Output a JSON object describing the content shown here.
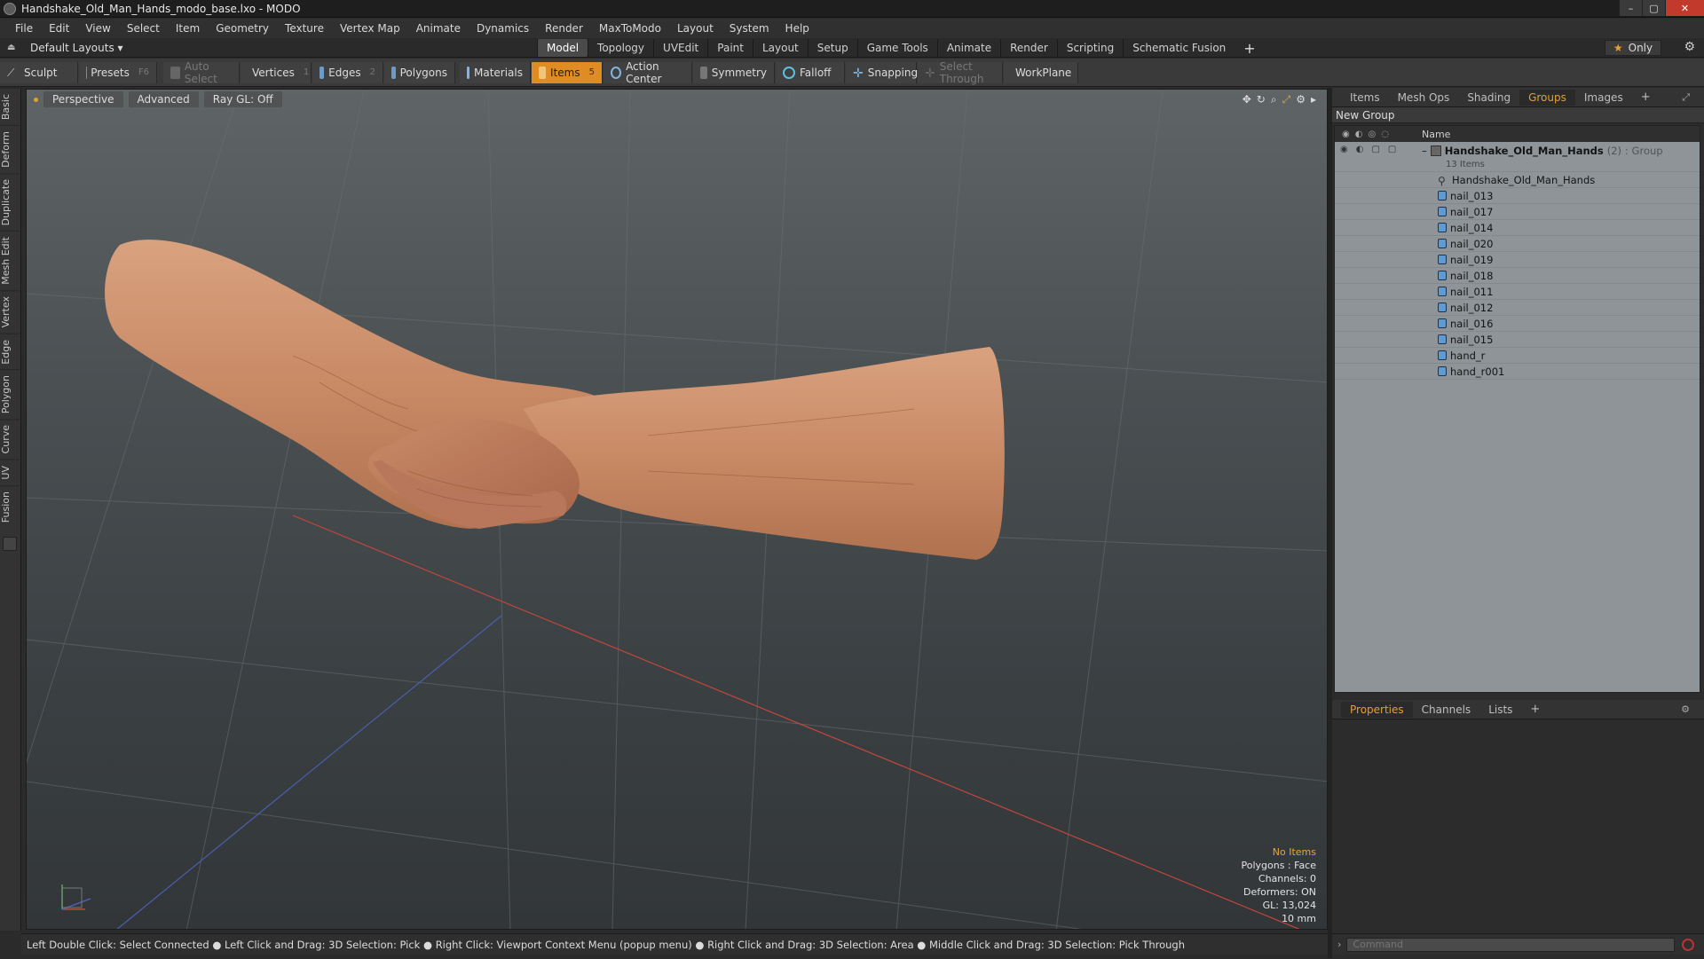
{
  "window": {
    "title": "Handshake_Old_Man_Hands_modo_base.lxo - MODO",
    "min": "–",
    "max": "▢",
    "close": "✕"
  },
  "menu": [
    "File",
    "Edit",
    "View",
    "Select",
    "Item",
    "Geometry",
    "Texture",
    "Vertex Map",
    "Animate",
    "Dynamics",
    "Render",
    "MaxToModo",
    "Layout",
    "System",
    "Help"
  ],
  "layout": {
    "default_layouts": "Default Layouts ▾",
    "tabs": [
      "Model",
      "Topology",
      "UVEdit",
      "Paint",
      "Layout",
      "Setup",
      "Game Tools",
      "Animate",
      "Render",
      "Scripting",
      "Schematic Fusion"
    ],
    "active_tab": "Model",
    "plus": "+",
    "only": "Only"
  },
  "toolbar": {
    "sculpt": "Sculpt",
    "presets": "Presets",
    "presets_key": "F6",
    "auto_select": "Auto Select",
    "vertices": "Vertices",
    "vertices_key": "1",
    "edges": "Edges",
    "edges_key": "2",
    "polygons": "Polygons",
    "materials": "Materials",
    "items": "Items",
    "items_key": "5",
    "action_center": "Action Center",
    "symmetry": "Symmetry",
    "falloff": "Falloff",
    "snapping": "Snapping",
    "select_through": "Select Through",
    "workplane": "WorkPlane"
  },
  "left_tabs": [
    "Basic",
    "Deform",
    "Duplicate",
    "Mesh Edit",
    "Vertex",
    "Edge",
    "Polygon",
    "Curve",
    "UV",
    "Fusion"
  ],
  "viewport": {
    "view": "Perspective",
    "advanced": "Advanced",
    "raygl": "Ray GL: Off",
    "info": {
      "no_items": "No Items",
      "polygons": "Polygons : Face",
      "channels": "Channels: 0",
      "deformers": "Deformers: ON",
      "gl": "GL: 13,024",
      "scale": "10 mm"
    }
  },
  "status": "Left Double Click: Select Connected ● Left Click and Drag: 3D Selection: Pick ● Right Click: Viewport Context Menu (popup menu) ● Right Click and Drag: 3D Selection: Area ● Middle Click and Drag: 3D Selection: Pick Through",
  "panel": {
    "tabs": [
      "Items",
      "Mesh Ops",
      "Shading",
      "Groups",
      "Images"
    ],
    "active_tab": "Groups",
    "new_group": "New Group",
    "name_col": "Name",
    "group": {
      "name": "Handshake_Old_Man_Hands",
      "count": "(2)",
      "type": ": Group",
      "items": "13 Items"
    },
    "children": [
      "Handshake_Old_Man_Hands",
      "nail_013",
      "nail_017",
      "nail_014",
      "nail_020",
      "nail_019",
      "nail_018",
      "nail_011",
      "nail_012",
      "nail_016",
      "nail_015",
      "hand_r",
      "hand_r001"
    ],
    "bottom_tabs": [
      "Properties",
      "Channels",
      "Lists"
    ],
    "bottom_active": "Properties",
    "command_placeholder": "Command"
  },
  "colors": {
    "accent": "#e08c25",
    "viewport_top": "#5f6466",
    "viewport_bottom": "#323638"
  }
}
